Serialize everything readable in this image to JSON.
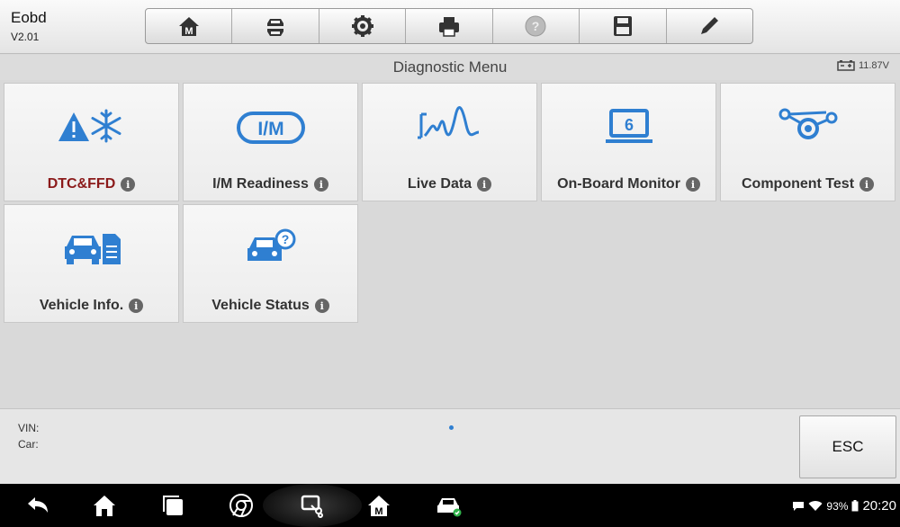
{
  "app": {
    "name": "Eobd",
    "version": "V2.01"
  },
  "toolbar": {
    "items": [
      {
        "icon": "home-icon"
      },
      {
        "icon": "vehicle-swap-icon"
      },
      {
        "icon": "gear-icon"
      },
      {
        "icon": "printer-icon"
      },
      {
        "icon": "help-icon"
      },
      {
        "icon": "save-icon"
      },
      {
        "icon": "pencil-icon"
      }
    ]
  },
  "header": {
    "title": "Diagnostic Menu",
    "battery_voltage": "11.87V"
  },
  "menu": {
    "tiles": [
      {
        "label": "DTC&FFD",
        "icon": "warning-snowflake-icon",
        "highlight": true
      },
      {
        "label": "I/M Readiness",
        "icon": "im-readiness-icon",
        "icon_text": "I/M"
      },
      {
        "label": "Live Data",
        "icon": "live-data-graph-icon"
      },
      {
        "label": "On-Board Monitor",
        "icon": "onboard-monitor-icon",
        "icon_text": "6"
      },
      {
        "label": "Component Test",
        "icon": "component-test-icon"
      },
      {
        "label": "Vehicle Info.",
        "icon": "vehicle-info-icon"
      },
      {
        "label": "Vehicle Status",
        "icon": "vehicle-status-icon"
      }
    ],
    "info_glyph": "i"
  },
  "footer": {
    "vin_label": "VIN:",
    "car_label": "Car:",
    "esc_label": "ESC"
  },
  "system": {
    "battery_percent": "93%",
    "time": "20:20"
  },
  "colors": {
    "accent_blue": "#2f7fd1",
    "highlight_red": "#8b1a1a"
  }
}
